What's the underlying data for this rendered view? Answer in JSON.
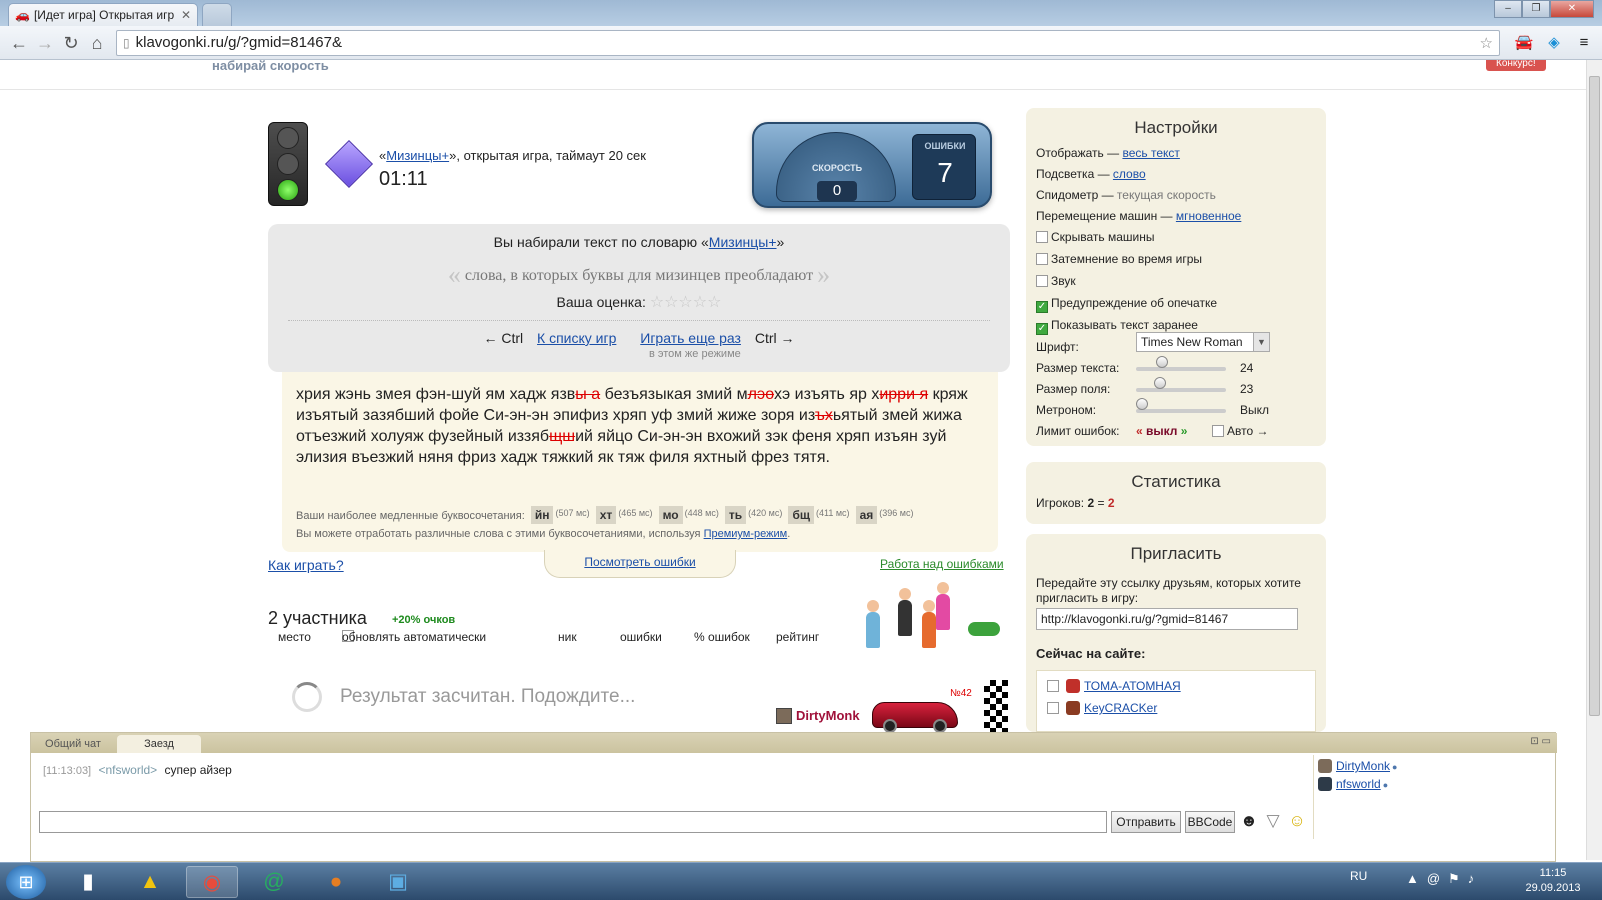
{
  "browser": {
    "tab_title": "[Идет игра] Открытая игр",
    "url": "klavogonki.ru/g/?gmid=81467&"
  },
  "header": {
    "slogan": "набирай скорость",
    "contest": "Конкурс!"
  },
  "game": {
    "title_prefix": "«",
    "dict_link": "Мизинцы+",
    "title_suffix": "», открытая игра, таймаут 20 сек",
    "timer": "01:11",
    "speed_label": "СКОРОСТЬ",
    "speed_value": "0",
    "errors_label": "ОШИБКИ",
    "errors_value": "7"
  },
  "result": {
    "dict_prefix": "Вы набирали текст по словарю «",
    "dict_name": "Мизинцы+",
    "dict_suffix": "»",
    "dict_desc": "слова, в которых буквы для мизинцев преобладают",
    "rating_label": "Ваша оценка:",
    "left_ctrl": "← Ctrl",
    "list_link": "К списку игр",
    "again_link": "Играть еще раз",
    "right_ctrl": "Ctrl →",
    "same_mode": "в этом же режиме"
  },
  "typed": {
    "parts": [
      "хрия жэнь змея фэн-шуй ям хадж язв",
      "ы а",
      " безъязыкая змий м",
      "лэо",
      "хэ изъять яр х",
      "ирри я",
      "\nкряж изъятый зазябший фойе Си-эн-эн эпифиз хряп уф змий жиже зоря из",
      "ъх",
      "ьятый змей жижа отъезжий холуяж фузейный иззяб",
      "щш",
      "ий яйцо Си-эн-эн вхожий зэк феня хряп изъян зуй элизия въезжий няня фриз хадж тяжкий як тяж филя яхтный фрез тятя."
    ],
    "slow_label": "Ваши наиболее медленные буквосочетания:",
    "combos": [
      {
        "c": "йн",
        "ms": "(507 мс)"
      },
      {
        "c": "хт",
        "ms": "(465 мс)"
      },
      {
        "c": "мо",
        "ms": "(448 мс)"
      },
      {
        "c": "ть",
        "ms": "(420 мс)"
      },
      {
        "c": "бщ",
        "ms": "(411 мс)"
      },
      {
        "c": "ая",
        "ms": "(396 мс)"
      }
    ],
    "practice_text": "Вы можете отработать различные слова с этими буквосочетаниями, используя",
    "premium_link": "Премиум-режим",
    "period": "."
  },
  "links": {
    "how_to_play": "Как играть?",
    "view_errors": "Посмотреть ошибки",
    "work_errors": "Работа над ошибками"
  },
  "participants": {
    "title": "2 участника",
    "bonus": "+20% очков",
    "col_place": "место",
    "auto_update": "обновлять автоматически",
    "col_nick": "ник",
    "col_errors": "ошибки",
    "col_err_pct": "% ошибок",
    "col_rating": "рейтинг",
    "result_msg": "Результат засчитан. Подождите...",
    "racer": "DirtyMonk",
    "car_number": "№42"
  },
  "settings": {
    "title": "Настройки",
    "display_label": "Отображать —",
    "display_value": "весь текст",
    "highlight_label": "Подсветка —",
    "highlight_value": "слово",
    "speedo_label": "Спидометр —",
    "speedo_value": "текущая скорость",
    "cars_move_label": "Перемещение машин —",
    "cars_move_value": "мгновенное",
    "hide_cars": "Скрывать машины",
    "dim": "Затемнение во время игры",
    "sound": "Звук",
    "typo_warn": "Предупреждение об опечатке",
    "show_text": "Показывать текст заранее",
    "font_label": "Шрифт:",
    "font_value": "Times New Roman",
    "text_size_label": "Размер текста:",
    "text_size_value": "24",
    "field_size_label": "Размер поля:",
    "field_size_value": "23",
    "metronome_label": "Метроном:",
    "metronome_value": "Выкл",
    "limit_label": "Лимит ошибок:",
    "limit_left": "«",
    "limit_value": "выкл",
    "limit_right": "»",
    "auto_label": "Авто →",
    "text_size_level": 0.25,
    "field_size_level": 0.22,
    "metronome_level": 0.0
  },
  "stats": {
    "title": "Статистика",
    "players_label": "Игроков:",
    "players_value": "2",
    "eq": "=",
    "players_total": "2"
  },
  "invite": {
    "title": "Пригласить",
    "desc": "Передайте эту ссылку друзьям, которых хотите пригласить в игру:",
    "url": "http://klavogonki.ru/g/?gmid=81467",
    "online_title": "Сейчас на сайте:",
    "users": [
      "ТОМА-АТОМНАЯ",
      "KeyCRACKer"
    ]
  },
  "chat": {
    "tab_general": "Общий чат",
    "tab_race": "Заезд",
    "msg_time": "[11:13:03]",
    "msg_nick": "<nfsworld>",
    "msg_text": "супер айзер",
    "users": [
      "DirtyMonk",
      "nfsworld"
    ],
    "send": "Отправить",
    "bbcode": "BBCode"
  },
  "taskbar": {
    "lang": "RU",
    "time": "11:15",
    "date": "29.09.2013"
  },
  "colors": {
    "error_text": "#d00000",
    "link": "#1b4fa8",
    "racer": "#a0113a"
  }
}
